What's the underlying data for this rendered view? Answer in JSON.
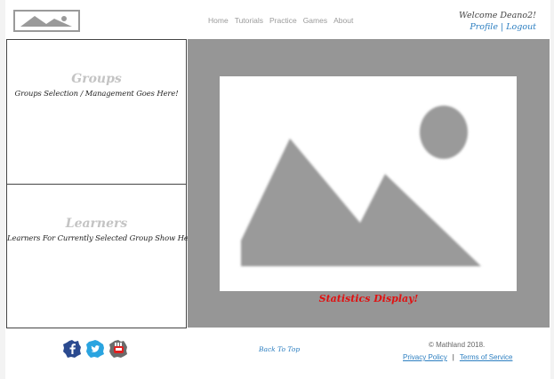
{
  "header": {
    "nav": [
      "Home",
      "Tutorials",
      "Practice",
      "Games",
      "About"
    ],
    "welcome": "Welcome Deano2!",
    "profile_link": "Profile",
    "separator": "|",
    "logout_link": "Logout"
  },
  "groups": {
    "title": "Groups",
    "subtitle": "Groups Selection / Management Goes Here!"
  },
  "learners": {
    "title": "Learners",
    "subtitle": "Learners For Currently Selected Group Show Here!"
  },
  "stats": {
    "caption": "Statistics Display!"
  },
  "footer": {
    "social_icons": [
      "facebook-icon",
      "twitter-icon",
      "youtube-icon"
    ],
    "back_to_top": "Back To Top",
    "copyright": "© Mathland 2018.",
    "privacy": "Privacy Policy",
    "separator": "|",
    "terms": "Terms of Service"
  },
  "colors": {
    "accent": "#2d7fc1",
    "stats_bg": "#969696",
    "caption": "#e01010"
  }
}
